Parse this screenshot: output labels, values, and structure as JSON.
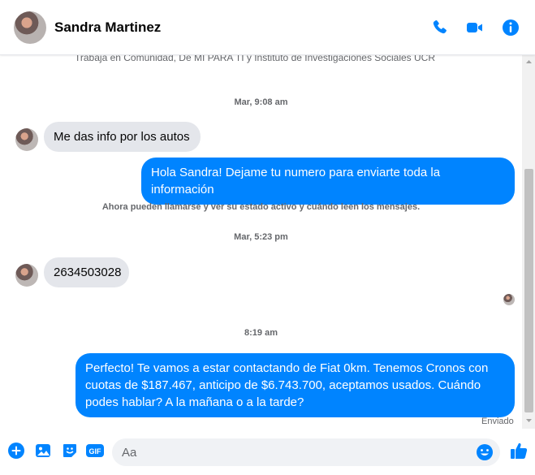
{
  "header": {
    "name": "Sandra Martinez",
    "icons": [
      "phone-icon",
      "video-icon",
      "info-icon"
    ]
  },
  "accent": "#0084ff",
  "chat": {
    "faded_text": "Trabaja en Comunidad, De MI PARA TI y Instituto de Investigaciones Sociales UCR",
    "time1": "Mar, 9:08 am",
    "msg1": "Me das info por los autos",
    "msg2": "Hola Sandra! Dejame tu numero para enviarte toda la información",
    "system_notice": "Ahora pueden llamarse y ver su estado activo y cuándo leen los mensajes.",
    "time2": "Mar, 5:23 pm",
    "msg3": "2634503028",
    "time3": "8:19 am",
    "msg4": "Perfecto! Te vamos a estar contactando de Fiat 0km. Tenemos Cronos con cuotas de $187.467, anticipo de $6.743.700, aceptamos usados. Cuándo podes hablar? A la mañana o a la tarde?",
    "status": "Enviado"
  },
  "composer": {
    "placeholder": "Aa",
    "icons": [
      "plus-icon",
      "image-icon",
      "sticker-icon",
      "gif-icon",
      "emoji-icon",
      "like-icon"
    ]
  }
}
